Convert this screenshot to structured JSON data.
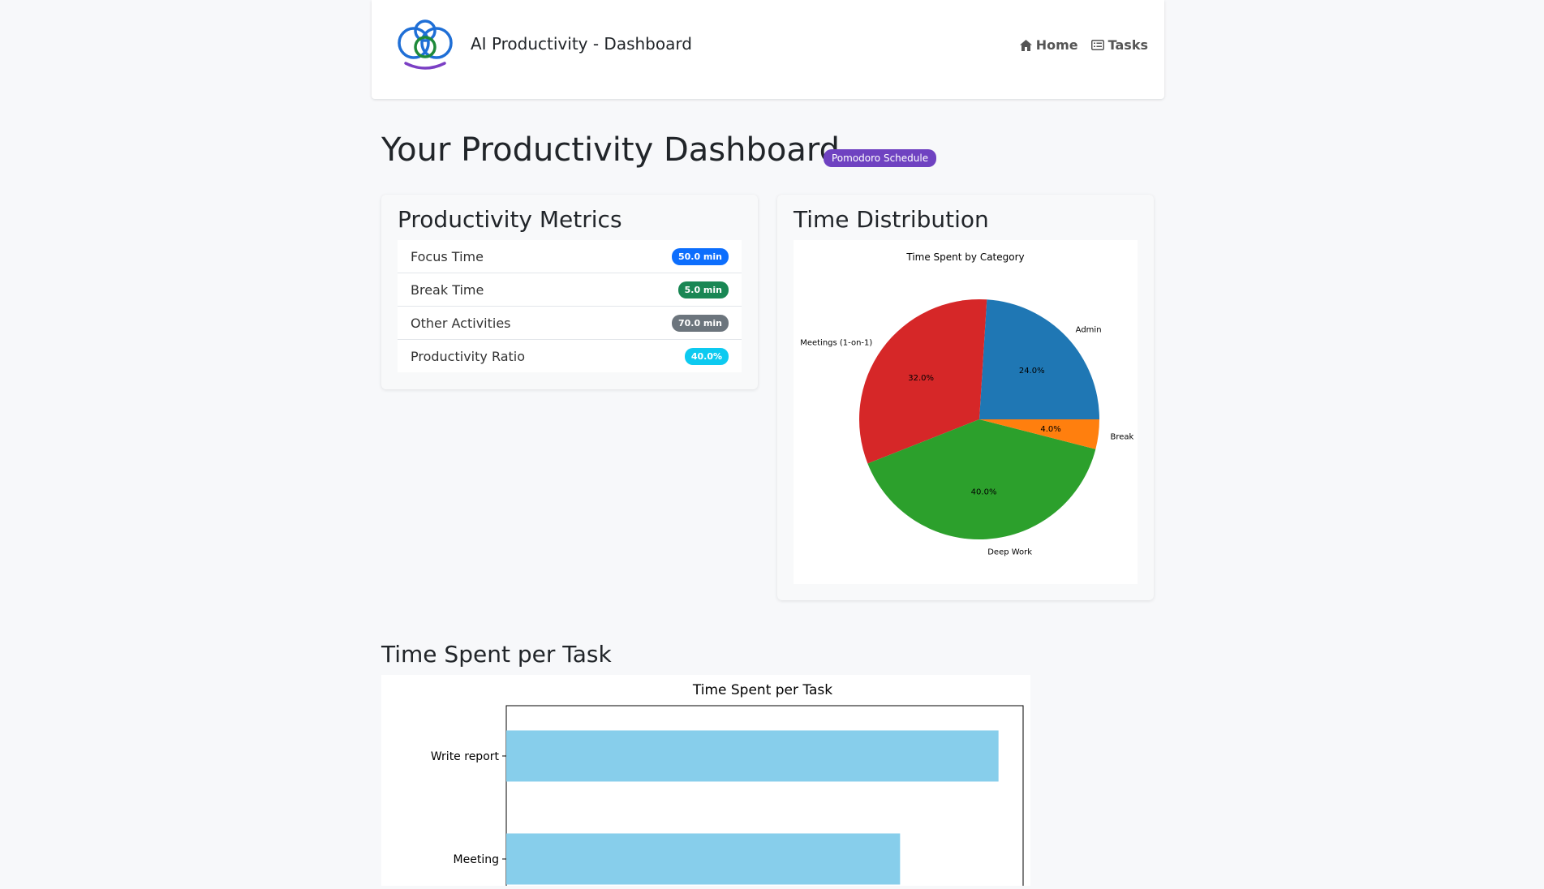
{
  "header": {
    "app_title": "AI Productivity - Dashboard",
    "nav": [
      {
        "label": "Home",
        "icon": "home-icon"
      },
      {
        "label": "Tasks",
        "icon": "list-icon"
      }
    ]
  },
  "main": {
    "title": "Your Productivity Dashboard",
    "badge": "Pomodoro Schedule",
    "badge_color": "#6f42c1"
  },
  "metrics": {
    "title": "Productivity Metrics",
    "items": [
      {
        "label": "Focus Time",
        "value": "50.0 min",
        "color": "#0d6efd"
      },
      {
        "label": "Break Time",
        "value": "5.0 min",
        "color": "#198754"
      },
      {
        "label": "Other Activities",
        "value": "70.0 min",
        "color": "#6c757d"
      },
      {
        "label": "Productivity Ratio",
        "value": "40.0%",
        "color": "#0dcaf0"
      }
    ]
  },
  "distribution": {
    "title": "Time Distribution"
  },
  "tasks_section": {
    "title": "Time Spent per Task"
  },
  "chart_data": [
    {
      "type": "pie",
      "title": "Time Spent by Category",
      "slices": [
        {
          "label": "Admin",
          "value": 24.0,
          "pct_label": "24.0%",
          "color": "#1f77b4"
        },
        {
          "label": "Meetings (1-on-1)",
          "value": 32.0,
          "pct_label": "32.0%",
          "color": "#d62728"
        },
        {
          "label": "Deep Work",
          "value": 40.0,
          "pct_label": "40.0%",
          "color": "#2ca02c"
        },
        {
          "label": "Break",
          "value": 4.0,
          "pct_label": "4.0%",
          "color": "#ff7f0e"
        }
      ]
    },
    {
      "type": "bar",
      "orientation": "horizontal",
      "title": "Time Spent per Task",
      "categories": [
        "Write report",
        "Meeting"
      ],
      "values": [
        50,
        40
      ],
      "xlim": [
        0,
        52.5
      ],
      "color": "#87ceeb"
    }
  ]
}
